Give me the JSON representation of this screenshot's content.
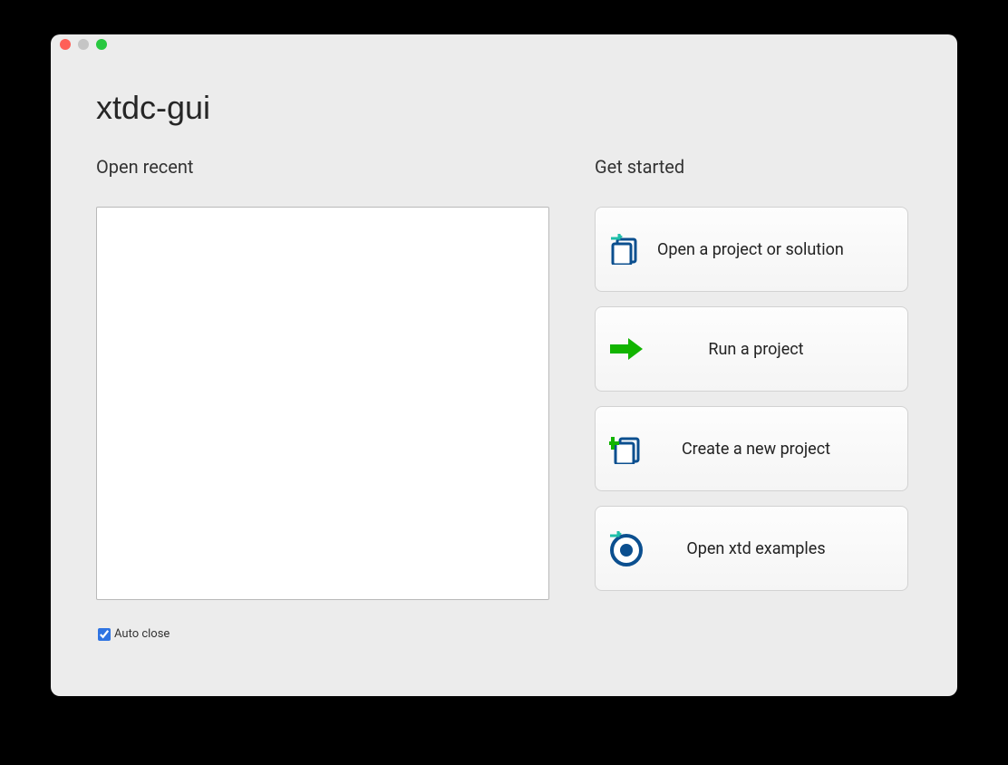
{
  "app": {
    "title": "xtdc-gui"
  },
  "left": {
    "heading": "Open recent"
  },
  "auto_close": {
    "label": "Auto close",
    "checked": true
  },
  "right": {
    "heading": "Get started",
    "actions": {
      "open_project": "Open a project or solution",
      "run_project": "Run a project",
      "create_project": "Create a new project",
      "open_examples": "Open xtd examples"
    }
  }
}
